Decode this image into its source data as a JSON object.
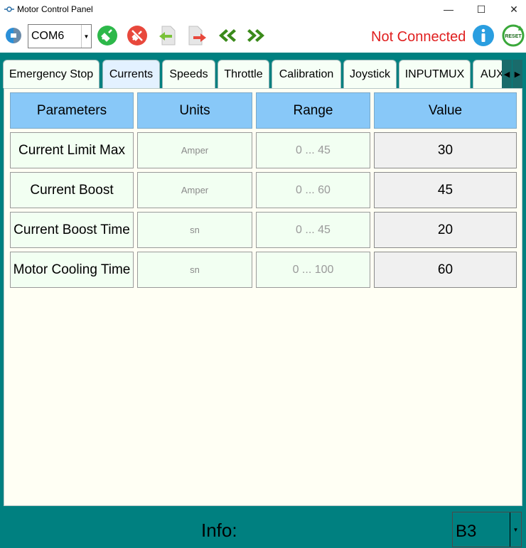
{
  "window": {
    "title": "Motor Control Panel",
    "minimize_glyph": "—",
    "maximize_glyph": "☐",
    "close_glyph": "✕"
  },
  "toolbar": {
    "port_value": "COM6",
    "status": "Not Connected",
    "status_color": "#e02020",
    "icons": [
      "connection-logo-icon",
      "plug-connect-icon",
      "plug-disconnect-icon",
      "download-icon",
      "upload-icon",
      "previous-icon",
      "next-icon",
      "info-icon",
      "reset-icon"
    ],
    "reset_label": "RESET"
  },
  "tabs": {
    "items": [
      "Emergency Stop",
      "Currents",
      "Speeds",
      "Throttle",
      "Calibration",
      "Joystick",
      "INPUTMUX",
      "AUX"
    ],
    "active": "Currents"
  },
  "table": {
    "headers": [
      "Parameters",
      "Units",
      "Range",
      "Value"
    ],
    "rows": [
      {
        "name": "Current Limit Max",
        "unit": "Amper",
        "range": "0 ... 45",
        "value": "30"
      },
      {
        "name": "Current Boost",
        "unit": "Amper",
        "range": "0 ... 60",
        "value": "45"
      },
      {
        "name": "Current Boost Time",
        "unit": "sn",
        "range": "0 ... 45",
        "value": "20"
      },
      {
        "name": "Motor Cooling Time",
        "unit": "sn",
        "range": "0 ... 100",
        "value": "60"
      }
    ]
  },
  "footer": {
    "info_label": "Info:",
    "selector_value": "B3"
  },
  "colors": {
    "frame": "#008080",
    "header": "#88c8f8",
    "panel": "#fffff4"
  }
}
